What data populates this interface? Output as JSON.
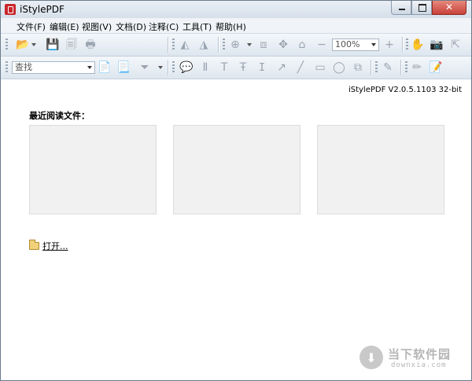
{
  "window": {
    "title": "iStylePDF"
  },
  "window_controls": {
    "close_glyph": "✕"
  },
  "menu": [
    {
      "label": "文件(F)"
    },
    {
      "label": "编辑(E)"
    },
    {
      "label": "视图(V)"
    },
    {
      "label": "文档(D)"
    },
    {
      "label": "注释(C)"
    },
    {
      "label": "工具(T)"
    },
    {
      "label": "帮助(H)"
    }
  ],
  "toolbar": {
    "zoom_value": "100%",
    "search_value": "查找"
  },
  "toolbar_icons": {
    "open": "📂",
    "save": "💾",
    "save_all": "🗐",
    "print": "🖶",
    "rotate_left": "◭",
    "rotate_right": "◮",
    "zoom_in": "⊕",
    "fit_page": "⧈",
    "fit_width": "✥",
    "actual_size": "⌂",
    "zoom_out": "−",
    "zoom_plus": "+",
    "hand": "✋",
    "snapshot": "📷",
    "select": "⇱",
    "page_props": "📄",
    "doc_props": "📃",
    "filter": "⏷",
    "note": "💬",
    "typewriter": "Ⅱ",
    "text": "T",
    "strikeout": "Ŧ",
    "insert_text": "ⵊ",
    "arrow": "↗",
    "line": "╱",
    "rect": "▭",
    "ellipse": "◯",
    "stamp": "⧉",
    "pen": "✎",
    "pencil": "✏",
    "sign": "📝"
  },
  "content": {
    "version": "iStylePDF V2.0.5.1103 32-bit",
    "recent_title": "最近阅读文件：",
    "open_link": "打开..."
  },
  "watermark": {
    "brand": "当下软件园",
    "url": "downxia.com",
    "icon_glyph": "⬇"
  }
}
